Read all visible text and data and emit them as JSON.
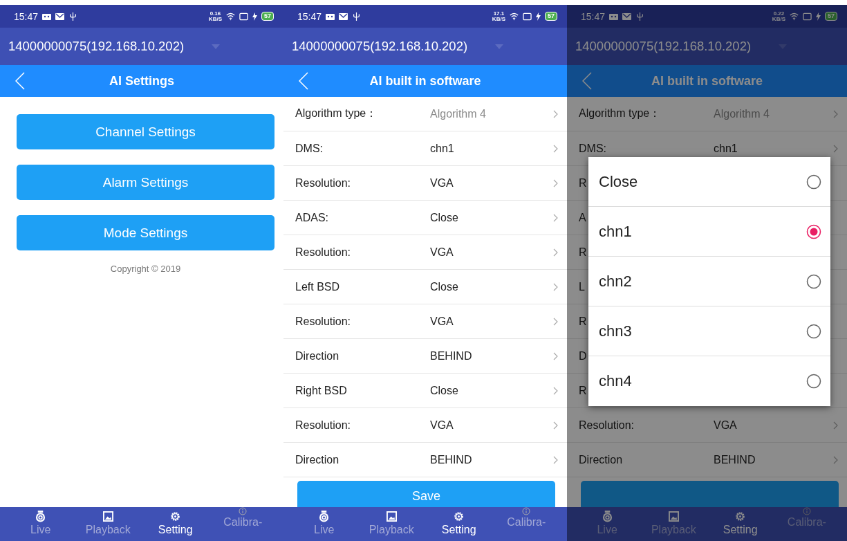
{
  "panels": [
    {
      "kind": "menu",
      "status": {
        "time": "15:47",
        "speed": "0.16",
        "speed_unit": "KB/S",
        "battery": "57"
      },
      "device": "14000000075(192.168.10.202)",
      "title": "AI Settings",
      "buttons": [
        "Channel Settings",
        "Alarm Settings",
        "Mode Settings"
      ],
      "copyright": "Copyright © 2019",
      "nav": [
        {
          "label": "Live",
          "kind": "live",
          "selected": false
        },
        {
          "label": "Playback",
          "kind": "playback",
          "selected": false
        },
        {
          "label": "Setting",
          "kind": "setting",
          "selected": true
        },
        {
          "label": "Calibra-",
          "kind": "calibration",
          "selected": false
        }
      ]
    },
    {
      "kind": "list",
      "status": {
        "time": "15:47",
        "speed": "17.1",
        "speed_unit": "KB/S",
        "battery": "57"
      },
      "device": "14000000075(192.168.10.202)",
      "title": "AI built in software",
      "rows": [
        {
          "label": "Algorithm type：",
          "value": "Algorithm 4",
          "disabled": true
        },
        {
          "label": "DMS:",
          "value": "chn1",
          "disabled": false
        },
        {
          "label": "Resolution:",
          "value": "VGA",
          "disabled": false
        },
        {
          "label": "ADAS:",
          "value": "Close",
          "disabled": false
        },
        {
          "label": "Resolution:",
          "value": "VGA",
          "disabled": false
        },
        {
          "label": "Left BSD",
          "value": "Close",
          "disabled": false
        },
        {
          "label": "Resolution:",
          "value": "VGA",
          "disabled": false
        },
        {
          "label": "Direction",
          "value": "BEHIND",
          "disabled": false
        },
        {
          "label": "Right BSD",
          "value": "Close",
          "disabled": false
        },
        {
          "label": "Resolution:",
          "value": "VGA",
          "disabled": false
        },
        {
          "label": "Direction",
          "value": "BEHIND",
          "disabled": false
        }
      ],
      "save": "Save",
      "nav": [
        {
          "label": "Live",
          "kind": "live",
          "selected": false
        },
        {
          "label": "Playback",
          "kind": "playback",
          "selected": false
        },
        {
          "label": "Setting",
          "kind": "setting",
          "selected": true
        },
        {
          "label": "Calibra-",
          "kind": "calibration",
          "selected": false
        }
      ]
    },
    {
      "kind": "list",
      "status": {
        "time": "15:47",
        "speed": "0.22",
        "speed_unit": "KB/S",
        "battery": "57"
      },
      "device": "14000000075(192.168.10.202)",
      "title": "AI built in software",
      "rows": [
        {
          "label": "Algorithm type：",
          "value": "Algorithm 4",
          "disabled": true
        },
        {
          "label": "DMS:",
          "value": "chn1",
          "disabled": false
        },
        {
          "label": "R"
        },
        {
          "label": "A"
        },
        {
          "label": "R"
        },
        {
          "label": "L"
        },
        {
          "label": "R"
        },
        {
          "label": "D"
        },
        {
          "label": "R"
        },
        {
          "label": "Resolution:",
          "value": "VGA",
          "disabled": false
        },
        {
          "label": "Direction",
          "value": "BEHIND",
          "disabled": false
        }
      ],
      "dialog": {
        "options": [
          {
            "label": "Close",
            "selected": false
          },
          {
            "label": "chn1",
            "selected": true
          },
          {
            "label": "chn2",
            "selected": false
          },
          {
            "label": "chn3",
            "selected": false
          },
          {
            "label": "chn4",
            "selected": false
          }
        ]
      },
      "nav": [
        {
          "label": "Live",
          "kind": "live",
          "selected": false
        },
        {
          "label": "Playback",
          "kind": "playback",
          "selected": false
        },
        {
          "label": "Setting",
          "kind": "setting",
          "selected": true
        },
        {
          "label": "Calibra-",
          "kind": "calibration",
          "selected": false
        }
      ]
    }
  ]
}
